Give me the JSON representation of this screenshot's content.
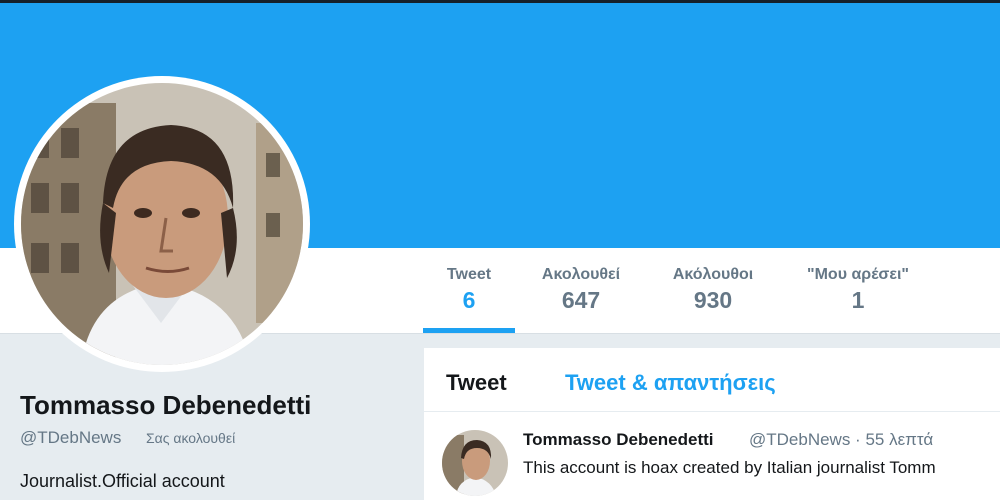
{
  "profile": {
    "name": "Tommasso Debenedetti",
    "handle": "@TDebNews",
    "follows_you": "Σας ακολουθεί",
    "bio": "Journalist.Official account"
  },
  "stats": [
    {
      "label": "Tweet",
      "value": "6"
    },
    {
      "label": "Ακολουθεί",
      "value": "647"
    },
    {
      "label": "Ακόλουθοι",
      "value": "930"
    },
    {
      "label": "\"Μου αρέσει\"",
      "value": "1"
    }
  ],
  "tabs": {
    "tweets": "Tweet",
    "tweets_replies": "Tweet & απαντήσεις"
  },
  "tweet": {
    "name": "Tommasso Debenedetti",
    "meta": "@TDebNews · 55 λεπτά",
    "text": "This account is hoax created by Italian journalist   Tomm"
  },
  "colors": {
    "banner": "#1da1f2",
    "accent": "#1da1f2",
    "muted": "#657786",
    "text": "#14171a",
    "page_bg": "#e6ecf0"
  }
}
